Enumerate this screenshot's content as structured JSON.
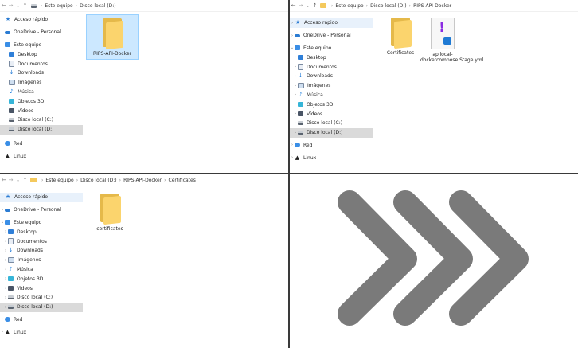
{
  "colors": {
    "divider": "#3a3a3a",
    "arrow": "#7a7a7a",
    "selection": "#cce8ff",
    "tree_selected": "#dadada"
  },
  "pane1": {
    "path": [
      "Este equipo",
      "Disco local (D:)"
    ],
    "tree": [
      {
        "label": "Acceso rápido",
        "icon": "star-icon"
      },
      {
        "label": "OneDrive - Personal",
        "icon": "cloud-icon"
      },
      {
        "label": "Este equipo",
        "icon": "computer-icon"
      },
      {
        "label": "Desktop",
        "icon": "desktop-icon"
      },
      {
        "label": "Documentos",
        "icon": "document-icon"
      },
      {
        "label": "Downloads",
        "icon": "download-icon"
      },
      {
        "label": "Imágenes",
        "icon": "image-icon"
      },
      {
        "label": "Música",
        "icon": "music-icon"
      },
      {
        "label": "Objetos 3D",
        "icon": "cube-icon"
      },
      {
        "label": "Vídeos",
        "icon": "film-icon"
      },
      {
        "label": "Disco local (C:)",
        "icon": "drive-icon"
      },
      {
        "label": "Disco local (D:)",
        "icon": "drive-icon"
      },
      {
        "label": "Red",
        "icon": "network-icon"
      },
      {
        "label": "Linux",
        "icon": "linux-icon"
      }
    ],
    "files": [
      {
        "label": "RIPS-API-Docker",
        "type": "folder"
      }
    ]
  },
  "pane2": {
    "path": [
      "Este equipo",
      "Disco local (D:)",
      "RIPS-API-Docker"
    ],
    "tree": [
      {
        "label": "Acceso rápido",
        "icon": "star-icon"
      },
      {
        "label": "OneDrive - Personal",
        "icon": "cloud-icon"
      },
      {
        "label": "Este equipo",
        "icon": "computer-icon"
      },
      {
        "label": "Desktop",
        "icon": "desktop-icon"
      },
      {
        "label": "Documentos",
        "icon": "document-icon"
      },
      {
        "label": "Downloads",
        "icon": "download-icon"
      },
      {
        "label": "Imágenes",
        "icon": "image-icon"
      },
      {
        "label": "Música",
        "icon": "music-icon"
      },
      {
        "label": "Objetos 3D",
        "icon": "cube-icon"
      },
      {
        "label": "Vídeos",
        "icon": "film-icon"
      },
      {
        "label": "Disco local (C:)",
        "icon": "drive-icon"
      },
      {
        "label": "Disco local (D:)",
        "icon": "drive-icon"
      },
      {
        "label": "Red",
        "icon": "network-icon"
      },
      {
        "label": "Linux",
        "icon": "linux-icon"
      }
    ],
    "files": [
      {
        "label": "Certificates",
        "type": "folder"
      },
      {
        "label": "apilocal-dockercompose.Stage.yml",
        "type": "yml"
      }
    ]
  },
  "pane3": {
    "path": [
      "Este equipo",
      "Disco local (D:)",
      "RIPS-API-Docker",
      "Certificates"
    ],
    "tree": [
      {
        "label": "Acceso rápido",
        "icon": "star-icon"
      },
      {
        "label": "OneDrive - Personal",
        "icon": "cloud-icon"
      },
      {
        "label": "Este equipo",
        "icon": "computer-icon"
      },
      {
        "label": "Desktop",
        "icon": "desktop-icon"
      },
      {
        "label": "Documentos",
        "icon": "document-icon"
      },
      {
        "label": "Downloads",
        "icon": "download-icon"
      },
      {
        "label": "Imágenes",
        "icon": "image-icon"
      },
      {
        "label": "Música",
        "icon": "music-icon"
      },
      {
        "label": "Objetos 3D",
        "icon": "cube-icon"
      },
      {
        "label": "Videos",
        "icon": "film-icon"
      },
      {
        "label": "Disco local (C:)",
        "icon": "drive-icon"
      },
      {
        "label": "Disco local (D:)",
        "icon": "drive-icon"
      },
      {
        "label": "Red",
        "icon": "network-icon"
      },
      {
        "label": "Linux",
        "icon": "linux-icon"
      }
    ],
    "files": [
      {
        "label": "certificates",
        "type": "folder"
      }
    ]
  }
}
